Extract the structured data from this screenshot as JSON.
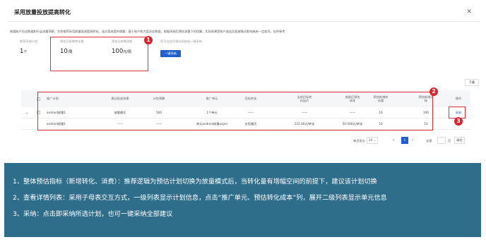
{
  "dialog": {
    "title": "采用放量投放提高转化",
    "close_icon": "close-icon",
    "description": "根据账户历史数据和行业流量洞察，为您推荐采用放量投放提高转化，该方案或提供增量：基于账户和大盘历史数据，根据采纳后预估流量下的估算，实际效果受账户收益及投放情况影响具有一定差异，仅供参考"
  },
  "metrics": [
    {
      "label": "推荐采纳计划",
      "value": "1",
      "unit": "个"
    },
    {
      "label": "预估可新增转化量",
      "value": "10",
      "unit": "/周"
    },
    {
      "label": "预估可新增消耗",
      "value": "100",
      "unit": "元/周"
    },
    {
      "label": "您可以在列表内采纳或一键采纳"
    }
  ],
  "adopt_all_label": "一键采纳",
  "download_label": "下载",
  "table": {
    "headers": [
      "推广计划",
      "建议投放场景",
      "计划预算",
      "推广单元",
      "目标转化",
      "当前目标转化出价",
      "放量后预估成本",
      "预估新增转化量",
      "预估新增消耗",
      "操作"
    ],
    "rows": [
      {
        "expand": "⌄",
        "plan": "android放量1",
        "scene": "放量模式",
        "budget": "500",
        "unit": "1个单元",
        "target": "——",
        "bid": "——",
        "cost": "——",
        "conv": "10",
        "spend": "100",
        "action": "采纳"
      },
      {
        "expand": "",
        "plan": "android放量1",
        "scene": "——",
        "budget": "——",
        "unit": "单元android放量ocpm",
        "target": "应用激活",
        "bid": "222.00元/转化",
        "cost": "50-500元/转化",
        "conv": "10",
        "spend": "10",
        "action": ""
      }
    ]
  },
  "pagination": {
    "per_page_label": "每页显示",
    "per_page_value": "20",
    "prev": "‹",
    "current": "1",
    "next": "›",
    "goto_label": "去第",
    "page_suffix": "页",
    "confirm": "确定"
  },
  "badges": [
    "1",
    "2",
    "3"
  ],
  "notes": [
    "1、整体预估指标（新增转化、消费）：推荐逻辑为预估计划切换为放量模式后，当转化量有增幅空间的前提下，建议该计划切换",
    "2、查看详情列表：采用子母表交互方式，一级列表显示计划信息，点击“推广单元、预估转化成本”列，展开二级列表显示单元信息",
    "3、采纳：点击即采纳所选计划，也可一键采纳全部建议"
  ],
  "colors": {
    "accent": "#1f5fcf",
    "highlight": "#e0303a",
    "badge": "#d9242f",
    "notes_bg": "#2f6e8b"
  }
}
